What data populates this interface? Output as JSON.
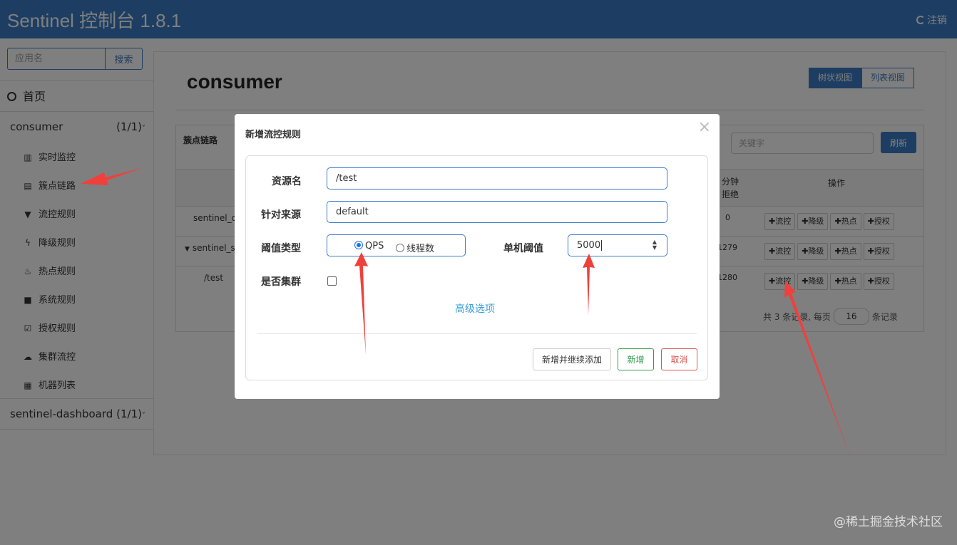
{
  "header": {
    "title": "Sentinel 控制台 1.8.1",
    "logout": "注销"
  },
  "sidebar": {
    "search_placeholder": "应用名",
    "search_button": "搜索",
    "home": "首页",
    "apps": [
      {
        "name": "consumer",
        "count": "(1/1)"
      },
      {
        "name": "sentinel-dashboard",
        "count": "(1/1)"
      }
    ],
    "items": [
      {
        "label": "实时监控",
        "icon": "bar-chart-icon"
      },
      {
        "label": "簇点链路",
        "icon": "list-icon"
      },
      {
        "label": "流控规则",
        "icon": "filter-icon"
      },
      {
        "label": "降级规则",
        "icon": "flash-icon"
      },
      {
        "label": "热点规则",
        "icon": "fire-icon"
      },
      {
        "label": "系统规则",
        "icon": "lock-icon"
      },
      {
        "label": "授权规则",
        "icon": "check-icon"
      },
      {
        "label": "集群流控",
        "icon": "cloud-icon"
      },
      {
        "label": "机器列表",
        "icon": "th-list-icon"
      }
    ]
  },
  "main": {
    "title": "consumer",
    "view_tree": "树状视图",
    "view_list": "列表视图",
    "table_title": "簇点链路",
    "keyword_placeholder": "关键字",
    "refresh": "刷新",
    "col_cut": "分钟拒绝",
    "col_ops": "操作",
    "rows": [
      {
        "name": "sentinel_de",
        "value": "0"
      },
      {
        "name": "sentinel_sp",
        "value": "51279"
      },
      {
        "name": "/test",
        "value": "51280"
      }
    ],
    "ops": [
      "流控",
      "降级",
      "热点",
      "授权"
    ],
    "pager_prefix": "共 3 条记录, 每页",
    "pager_size": "16",
    "pager_suffix": "条记录"
  },
  "modal": {
    "title": "新增流控规则",
    "close": "×",
    "resource_label": "资源名",
    "resource_value": "/test",
    "origin_label": "针对来源",
    "origin_value": "default",
    "threshold_type_label": "阈值类型",
    "radio_qps": "QPS",
    "radio_thread": "线程数",
    "threshold_label": "单机阈值",
    "threshold_value": "5000",
    "cluster_label": "是否集群",
    "advanced": "高级选项",
    "btn_add_continue": "新增并继续添加",
    "btn_add": "新增",
    "btn_cancel": "取消"
  },
  "watermark": "@稀土掘金技术社区",
  "colors": {
    "primary": "#3a7cc4",
    "success": "#2e9d4a",
    "danger": "#d9534f",
    "arrow": "#f0403c"
  }
}
